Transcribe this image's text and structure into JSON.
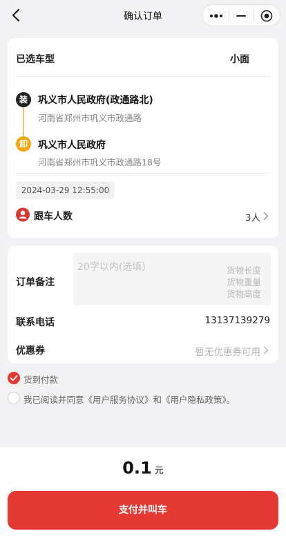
{
  "nav": {
    "title": "确认订单"
  },
  "vehicle": {
    "label": "已选车型",
    "value": "小面"
  },
  "route": {
    "load_badge": "装",
    "unload_badge": "卸",
    "start_title": "巩义市人民政府(政通路北)",
    "start_sub": "河南省郑州市巩义市政通路",
    "end_title": "巩义市人民政府",
    "end_sub": "河南省郑州市巩义市政通路18号"
  },
  "schedule": {
    "time": "2024-03-29 12:55:00"
  },
  "passengers": {
    "label": "跟车人数",
    "value": "3人"
  },
  "remark": {
    "label": "订单备注",
    "placeholder": "20字以内(选填)",
    "specs": [
      "货物长度",
      "货物重量",
      "货物高度"
    ]
  },
  "contact": {
    "label": "联系电话",
    "value": "13137139279"
  },
  "coupon": {
    "label": "优惠券",
    "value": "暂无优惠券可用"
  },
  "payment": {
    "cod_label": "货到付款"
  },
  "agreement": {
    "text": "我已阅读并同意《用户服务协议》和《用户隐私政策》。"
  },
  "footer": {
    "price": "0.1",
    "unit": "元",
    "pay_label": "支付并叫车"
  },
  "colors": {
    "accent": "#e53a33",
    "unload": "#f5a70f",
    "background": "#f2f2f4"
  }
}
